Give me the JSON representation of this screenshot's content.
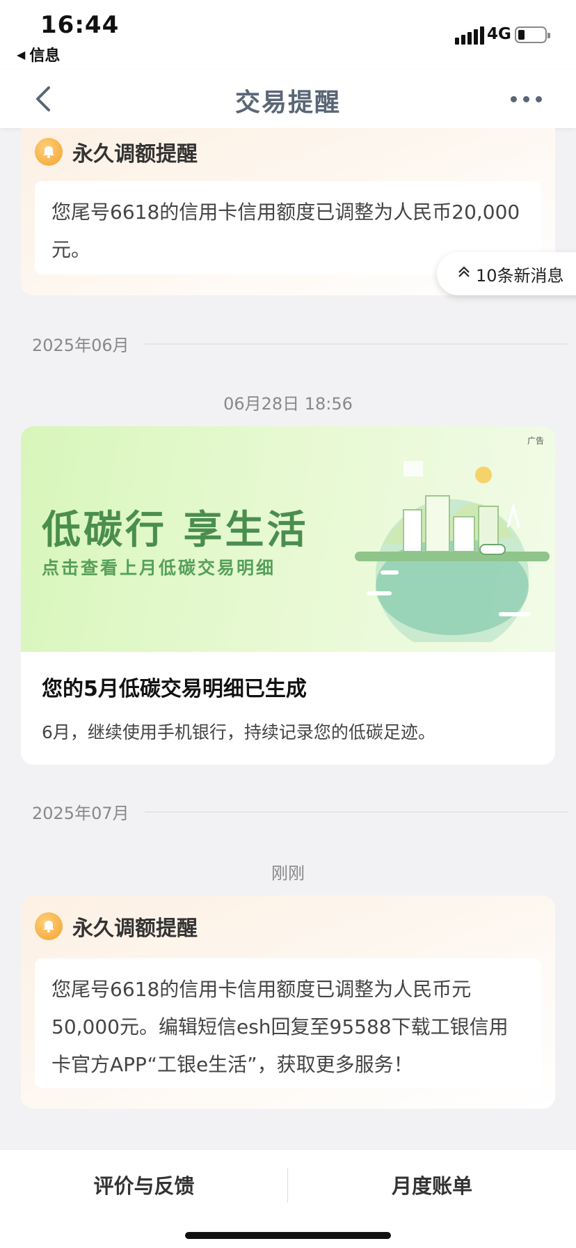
{
  "status_bar": {
    "time": "16:44",
    "back_app": "信息",
    "network": "4G"
  },
  "nav": {
    "title": "交易提醒"
  },
  "new_messages": {
    "label": "10条新消息"
  },
  "cards": [
    {
      "title": "永久调额提醒",
      "body": "您尾号6618的信用卡信用额度已调整为人民币20,000元。"
    },
    {
      "title": "永久调额提醒",
      "body": "您尾号6618的信用卡信用额度已调整为人民币元50,000元。编辑短信esh回复至95588下载工银信用卡官方APP“工银e生活”，获取更多服务！"
    }
  ],
  "months": [
    "2025年06月",
    "2025年07月"
  ],
  "timestamps": [
    "06月28日 18:56",
    "刚刚"
  ],
  "ad": {
    "tag": "广告",
    "headline": "低碳行 享生活",
    "subheadline": "点击查看上月低碳交易明细",
    "title": "您的5月低碳交易明细已生成",
    "subtitle": "6月，继续使用手机银行，持续记录您的低碳足迹。"
  },
  "bottom_bar": {
    "left": "评价与反馈",
    "right": "月度账单"
  },
  "colors": {
    "accent_orange": "#f2a22e",
    "nav_text": "#5a6676",
    "ad_green": "#4a8e4e"
  }
}
